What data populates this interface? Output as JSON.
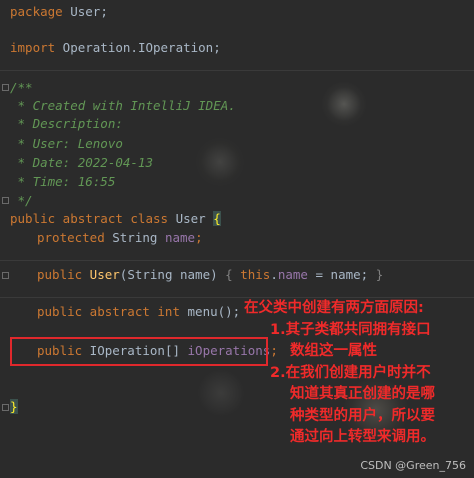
{
  "editor": {
    "colors": {
      "background": "#2b2b2b",
      "keyword": "#cc7832",
      "doc_comment": "#629755",
      "field": "#9876aa",
      "text": "#a9b7c6",
      "annotation_red": "#e0282c"
    },
    "code": {
      "package_kw": "package",
      "package_name": " User;",
      "import_kw": "import",
      "import_name": " Operation.IOperation;",
      "doc_open": "/**",
      "doc_created": " * Created with IntelliJ IDEA.",
      "doc_description": " * Description:",
      "doc_user": " * User: Lenovo",
      "doc_date": " * Date: 2022-04-13",
      "doc_time": " * Time: 16:55",
      "doc_close": " */",
      "class_kw": "public abstract class",
      "class_name": " User ",
      "class_brace": "{",
      "field_kw": "protected",
      "field_type": " String ",
      "field_name": "name",
      "field_semi": ";",
      "ctor_kw": "public",
      "ctor_name": " User",
      "ctor_params": "(String name) ",
      "ctor_body_open": "{",
      "ctor_this": " this",
      "ctor_dot": ".",
      "ctor_field": "name",
      "ctor_assign": " = name; ",
      "ctor_body_close": "}",
      "menu_kw": "public abstract int",
      "menu_sig": " menu();",
      "ops_kw": "public",
      "ops_type": " IOperation[] ",
      "ops_name": "iOperations",
      "ops_semi": ";",
      "class_close": "}"
    }
  },
  "annotation": {
    "line1": "在父类中创建有两方面原因:",
    "line2": "1.其子类都共同拥有接口",
    "line3": "数组这一属性",
    "line4": "2.在我们创建用户时并不",
    "line5": "知道其真正创建的是哪",
    "line6": "种类型的用户，所以要",
    "line7": "通过向上转型来调用。"
  },
  "watermark": "CSDN @Green_756"
}
